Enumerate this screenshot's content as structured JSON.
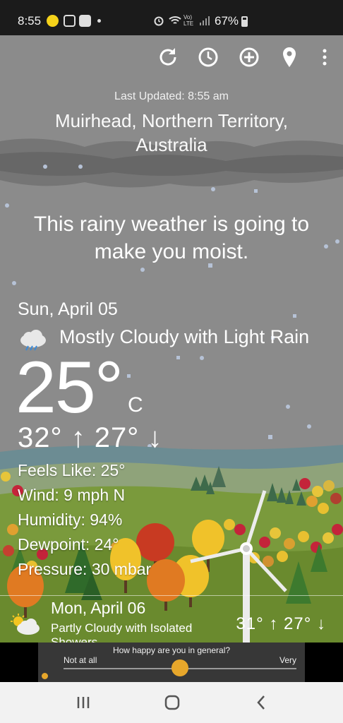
{
  "status_bar": {
    "time": "8:55",
    "network_label": "Vo) LTE",
    "battery": "67%"
  },
  "toolbar": {
    "icons": [
      "refresh-icon",
      "history-clock-icon",
      "add-location-icon",
      "location-pin-icon",
      "more-vert-icon"
    ]
  },
  "header": {
    "last_updated": "Last Updated: 8:55 am",
    "location": "Muirhead, Northern Territory, Australia"
  },
  "quote": "This rainy weather is going to make you moist.",
  "current": {
    "date": "Sun, April 05",
    "condition": "Mostly Cloudy with Light Rain",
    "condition_icon": "cloud-rain-icon",
    "temperature": "25°",
    "unit": "C",
    "hi_lo": "32° ↑ 27° ↓",
    "feels_like": "Feels Like: 25°",
    "wind": "Wind: 9 mph N",
    "humidity": "Humidity: 94%",
    "dewpoint": "Dewpoint: 24°",
    "pressure": "Pressure: 30 mbar"
  },
  "forecast": {
    "day": "Mon, April 06",
    "description_line1": "Partly Cloudy with Isolated",
    "description_line2": "Showers",
    "icon": "partly-cloudy-icon",
    "hi_lo": "31° ↑ 27° ↓"
  },
  "survey": {
    "question": "How happy are you in general?",
    "low_label": "Not at all",
    "high_label": "Very",
    "value": 0.5
  },
  "colors": {
    "sky": "#8b8b8b",
    "accent": "#e7a72b",
    "grass": "#7a9a3c"
  }
}
